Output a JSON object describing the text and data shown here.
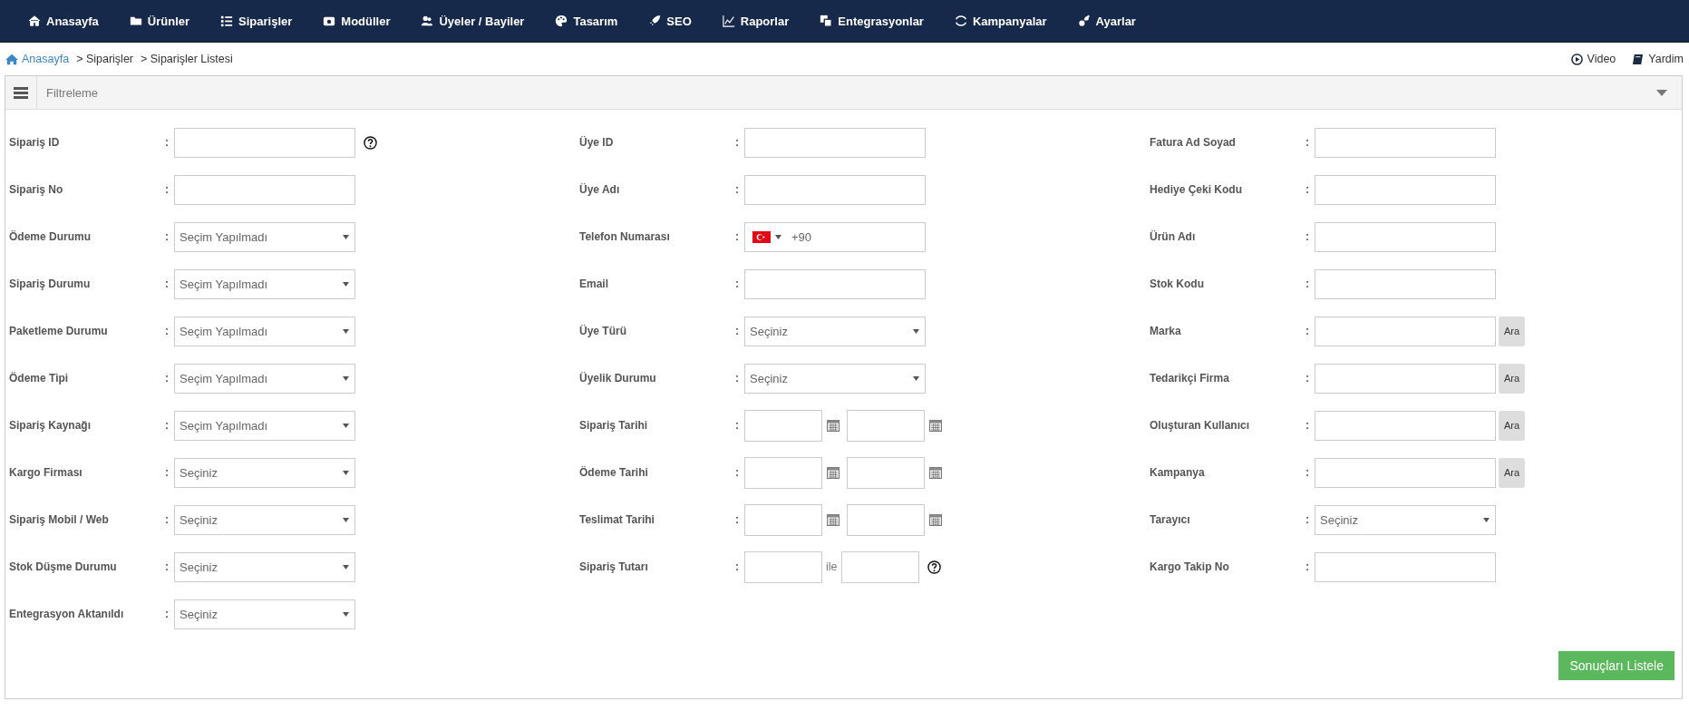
{
  "nav": {
    "items": [
      {
        "label": "Anasayfa"
      },
      {
        "label": "Ürünler"
      },
      {
        "label": "Siparişler"
      },
      {
        "label": "Modüller"
      },
      {
        "label": "Üyeler / Bayiler"
      },
      {
        "label": "Tasarım"
      },
      {
        "label": "SEO"
      },
      {
        "label": "Raporlar"
      },
      {
        "label": "Entegrasyonlar"
      },
      {
        "label": "Kampanyalar"
      },
      {
        "label": "Ayarlar"
      }
    ]
  },
  "breadcrumb": [
    {
      "label": "Anasayfa",
      "kind": "link"
    },
    {
      "label": "> Siparişler",
      "kind": "text"
    },
    {
      "label": "> Siparişler Listesi",
      "kind": "text"
    }
  ],
  "help_links": [
    {
      "label": "Video"
    },
    {
      "label": "Yardim"
    }
  ],
  "panel": {
    "title": "Filtreleme",
    "columns": [
      [
        {
          "label": "Sipariş ID",
          "sep": ":",
          "kind": "text",
          "help": true
        },
        {
          "label": "Sipariş No",
          "sep": ":",
          "kind": "text",
          "help": false
        },
        {
          "label": "Ödeme Durumu",
          "sep": ":",
          "kind": "select",
          "value": "Seçim Yapılmadı",
          "help": false
        },
        {
          "label": "Sipariş Durumu",
          "sep": ":",
          "kind": "select",
          "value": "Seçim Yapılmadı",
          "help": false
        },
        {
          "label": "Paketleme Durumu",
          "sep": ":",
          "kind": "select",
          "value": "Seçim Yapılmadı",
          "help": false
        },
        {
          "label": "Ödeme Tipi",
          "sep": ":",
          "kind": "select",
          "value": "Seçim Yapılmadı",
          "help": false
        },
        {
          "label": "Sipariş Kaynağı",
          "sep": ":",
          "kind": "select",
          "value": "Seçim Yapılmadı",
          "help": false
        },
        {
          "label": "Kargo Firması",
          "sep": ":",
          "kind": "select",
          "value": "Seçiniz",
          "help": false
        },
        {
          "label": "Sipariş Mobil / Web",
          "sep": ":",
          "kind": "select",
          "value": "Seçiniz",
          "help": false
        },
        {
          "label": "Stok Düşme Durumu",
          "sep": ":",
          "kind": "select",
          "value": "Seçiniz",
          "help": false
        },
        {
          "label": "Entegrasyon Aktanıldı",
          "sep": ":",
          "kind": "select",
          "value": "Seçiniz",
          "help": false
        }
      ],
      [
        {
          "label": "Üye ID",
          "sep": ":",
          "kind": "text",
          "help": false
        },
        {
          "label": "Üye Adı",
          "sep": ":",
          "kind": "text",
          "help": false
        },
        {
          "label": "Telefon Numarası",
          "sep": ":",
          "kind": "phone",
          "value": "+90",
          "help": false
        },
        {
          "label": "Email",
          "sep": ":",
          "kind": "text",
          "help": false
        },
        {
          "label": "Üye Türü",
          "sep": ":",
          "kind": "select",
          "value": "Seçiniz",
          "help": false
        },
        {
          "label": "Üyelik Durumu",
          "sep": ":",
          "kind": "select",
          "value": "Seçiniz",
          "help": false
        },
        {
          "label": "Sipariş Tarihi",
          "sep": ":",
          "kind": "daterange",
          "help": false
        },
        {
          "label": "Ödeme Tarihi",
          "sep": ":",
          "kind": "daterange",
          "help": false
        },
        {
          "label": "Teslimat Tarihi",
          "sep": ":",
          "kind": "daterange",
          "help": false
        },
        {
          "label": "Sipariş Tutarı",
          "sep": ":",
          "kind": "range",
          "between": "ile",
          "help": true
        }
      ],
      [
        {
          "label": "Fatura Ad Soyad",
          "sep": ":",
          "kind": "text",
          "help": false
        },
        {
          "label": "Hediye Çeki Kodu",
          "sep": ":",
          "kind": "text",
          "help": false
        },
        {
          "label": "Ürün Adı",
          "sep": ":",
          "kind": "text",
          "help": false
        },
        {
          "label": "Stok Kodu",
          "sep": ":",
          "kind": "text",
          "help": false
        },
        {
          "label": "Marka",
          "sep": ":",
          "kind": "search",
          "button": "Ara",
          "help": false
        },
        {
          "label": "Tedarikçi Firma",
          "sep": ":",
          "kind": "search",
          "button": "Ara",
          "help": false
        },
        {
          "label": "Oluşturan Kullanıcı",
          "sep": ":",
          "kind": "search",
          "button": "Ara",
          "help": false
        },
        {
          "label": "Kampanya",
          "sep": ":",
          "kind": "search",
          "button": "Ara",
          "help": false
        },
        {
          "label": "Tarayıcı",
          "sep": ":",
          "kind": "select",
          "value": "Seçiniz",
          "help": false
        },
        {
          "label": "Kargo Takip No",
          "sep": ":",
          "kind": "text",
          "help": false
        }
      ]
    ],
    "submit": "Sonuçları Listele"
  }
}
